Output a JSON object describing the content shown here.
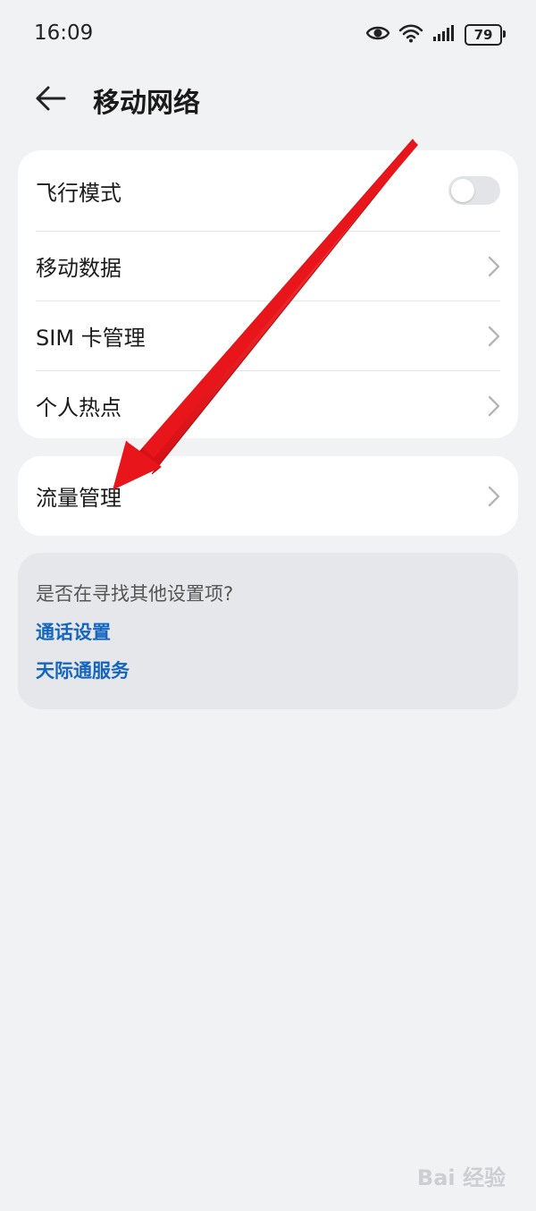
{
  "status_bar": {
    "time": "16:09",
    "battery": "79",
    "icons": [
      "eye-icon",
      "wifi-icon",
      "signal-icon",
      "battery-icon"
    ]
  },
  "header": {
    "title": "移动网络",
    "back_icon": "back-arrow-icon"
  },
  "settings_group": {
    "items": [
      {
        "label": "飞行模式",
        "control": "toggle",
        "on": false
      },
      {
        "label": "移动数据",
        "control": "chevron"
      },
      {
        "label": "SIM 卡管理",
        "control": "chevron"
      },
      {
        "label": "个人热点",
        "control": "chevron"
      }
    ]
  },
  "traffic_group": {
    "label": "流量管理"
  },
  "suggestions": {
    "title": "是否在寻找其他设置项?",
    "links": [
      "通话设置",
      "天际通服务"
    ]
  },
  "watermark": {
    "text": "Bai 经验"
  },
  "colors": {
    "background": "#f1f2f4",
    "card": "#ffffff",
    "link": "#1565c0",
    "annotation_arrow": "#e8151b"
  }
}
